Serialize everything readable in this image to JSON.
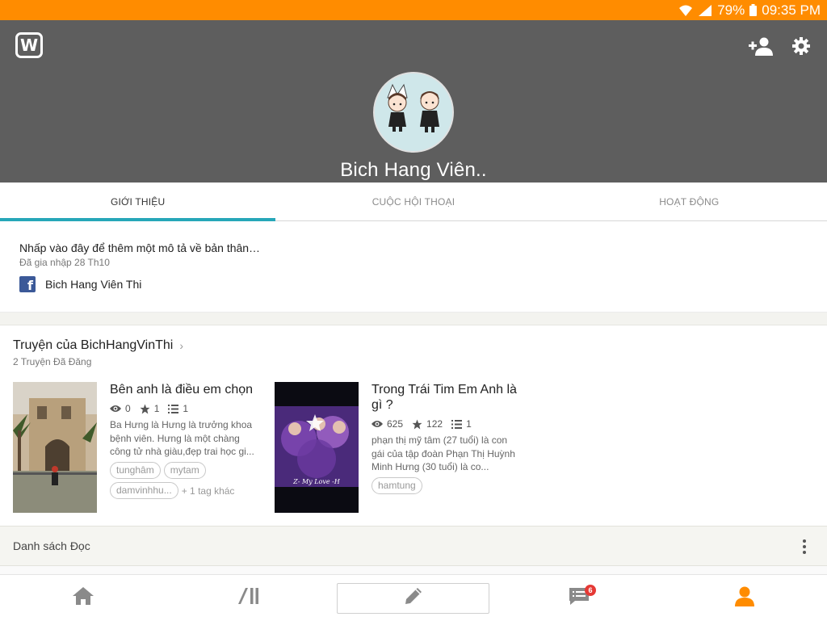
{
  "status_bar": {
    "battery": "79%",
    "time": "09:35 PM"
  },
  "header": {
    "logo_letter": "W",
    "profile_name": "Bich Hang Viên.."
  },
  "tabs": [
    {
      "label": "GIỚI THIỆU",
      "active": true
    },
    {
      "label": "CUỘC HỘI THOẠI",
      "active": false
    },
    {
      "label": "HOẠT ĐỘNG",
      "active": false
    }
  ],
  "about": {
    "description": "Nhấp vào đây để thêm một mô tả về bản thân…",
    "joined": "Đã gia nhập 28 Th10",
    "facebook_icon_letter": "f",
    "facebook_name": "Bich Hang Viên Thi"
  },
  "stories": {
    "title": "Truyện của BichHangVinThi",
    "chevron": "›",
    "count": "2 Truyện Đã Đăng",
    "items": [
      {
        "title": "Bên anh là điều em chọn",
        "reads": "0",
        "votes": "1",
        "parts": "1",
        "description": "Ba Hưng là Hưng là trưởng khoa bệnh viên. Hưng là một chàng công tử nhà giàu,đẹp trai học gi...",
        "tags": [
          "tunghâm",
          "mytam",
          "damvinhhu..."
        ],
        "more_tags": "+ 1 tag khác"
      },
      {
        "title": "Trong Trái Tim Em Anh là gì ?",
        "reads": "625",
        "votes": "122",
        "parts": "1",
        "description": "phạn thị mỹ tâm (27 tuổi) là con gái của tập đoàn Phạn Thị Huỳnh Minh Hưng (30 tuổi) là co...",
        "tags": [
          "hamtung"
        ],
        "cover_text": "Z- My Love -H"
      }
    ]
  },
  "reading_list": {
    "label": "Danh sách Đọc"
  },
  "bottom_nav": {
    "messages_badge": "6"
  },
  "colors": {
    "status_bar": "#ff8c00",
    "header": "#5e5e5e",
    "tab_indicator": "#26a7b8",
    "active_nav": "#ff8c00"
  }
}
